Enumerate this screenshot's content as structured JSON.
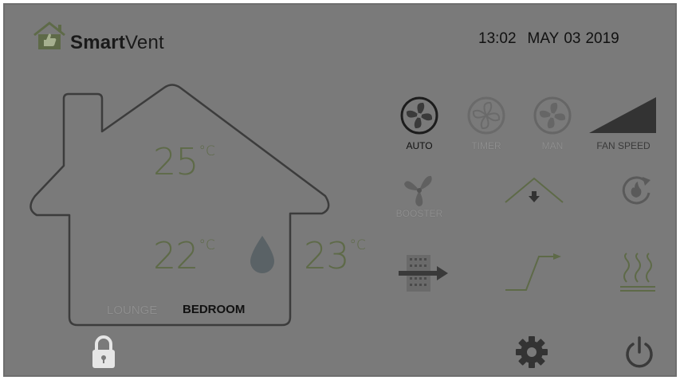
{
  "app": {
    "brand_bold": "Smart",
    "brand_light": "Vent"
  },
  "header": {
    "time": "13:02",
    "date_month": "MAY",
    "date_day": "03",
    "date_year": "2019"
  },
  "temperatures": {
    "upper": {
      "value": "25",
      "unit": "°C"
    },
    "lounge": {
      "value": "22",
      "unit": "°C"
    },
    "bedroom": {
      "value": "23",
      "unit": "°C"
    }
  },
  "rooms": {
    "lounge": "LOUNGE",
    "bedroom": "BEDROOM",
    "selected": "BEDROOM"
  },
  "modes": {
    "auto": "AUTO",
    "timer": "TIMER",
    "manual": "MAN",
    "fan_speed": "FAN SPEED",
    "booster": "BOOSTER",
    "selected": "AUTO"
  },
  "colors": {
    "background": "#7a7a7a",
    "temperature": "#5e6a48",
    "active_text": "#111111",
    "inactive_text": "#8f8f8f",
    "humidity_drop": "#5a6266"
  },
  "icons": {
    "logo": "house-thumbs-up-icon",
    "humidity": "water-drop-icon",
    "lock": "padlock-icon",
    "settings": "gear-icon",
    "power": "power-icon",
    "auto": "fan-icon",
    "timer": "fan-timer-icon",
    "manual": "fan-manual-icon",
    "fan_speed": "speed-ramp-icon",
    "booster": "booster-fan-icon",
    "roof_vent": "roof-arrow-icon",
    "recirculate": "recirculate-flame-icon",
    "filter": "filter-arrow-icon",
    "ramp": "ramp-arrow-icon",
    "heater": "heater-icon"
  }
}
